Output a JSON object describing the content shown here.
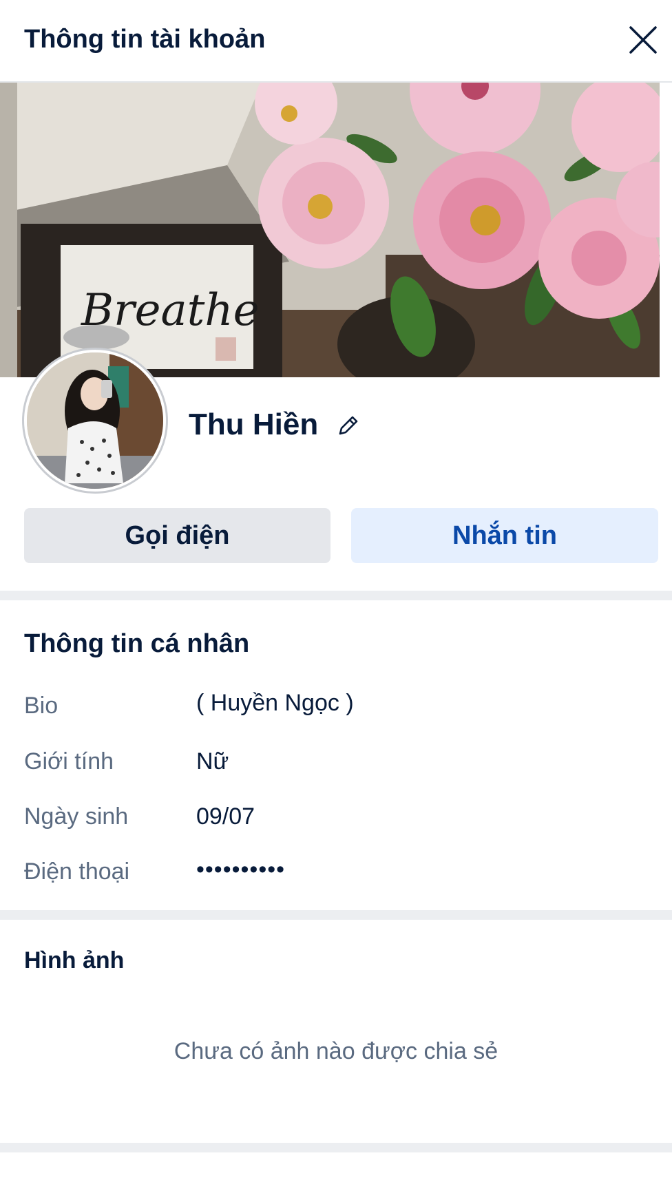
{
  "header": {
    "title": "Thông tin tài khoản",
    "close_icon": "close-icon"
  },
  "cover": {
    "image": "cover-photo",
    "sign_text": "Breathe"
  },
  "profile": {
    "avatar": "avatar",
    "name": "Thu Hiền",
    "edit_icon": "pencil-icon"
  },
  "actions": {
    "call_label": "Gọi điện",
    "message_label": "Nhắn tin"
  },
  "personal_info": {
    "title": "Thông tin cá nhân",
    "rows": [
      {
        "label": "Bio",
        "value": "( Huyền Ngọc )"
      },
      {
        "label": "Giới tính",
        "value": "Nữ"
      },
      {
        "label": "Ngày sinh",
        "value": "09/07"
      },
      {
        "label": "Điện thoại",
        "value": "••••••••••"
      }
    ]
  },
  "photos": {
    "title": "Hình ảnh",
    "empty_text": "Chưa có ảnh nào được chia sẻ"
  },
  "colors": {
    "primary_text": "#081b3a",
    "secondary_text": "#5a6a80",
    "message_button_bg": "#e5effe",
    "message_button_text": "#0b49a8",
    "call_button_bg": "#e5e7eb"
  }
}
